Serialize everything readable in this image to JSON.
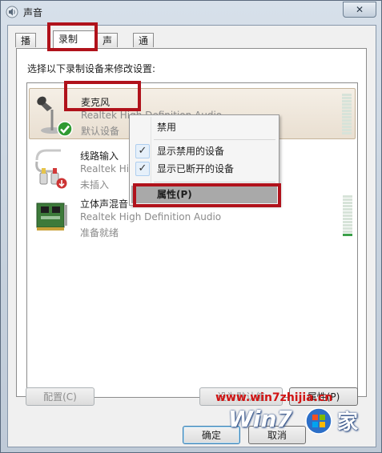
{
  "window": {
    "title": "声音",
    "close_glyph": "✕"
  },
  "tabs": [
    {
      "label": "播放",
      "active": false
    },
    {
      "label": "录制",
      "active": true
    },
    {
      "label": "声音",
      "active": false
    },
    {
      "label": "通信",
      "active": false
    }
  ],
  "panel": {
    "instruction": "选择以下录制设备来修改设置:"
  },
  "devices": [
    {
      "name": "麦克风",
      "description": "Realtek High Definition Audio",
      "status": "默认设备",
      "icon": "microphone-icon",
      "badge": "default-check-icon",
      "selected": true
    },
    {
      "name": "线路输入",
      "description": "Realtek High Definition Audio",
      "status": "未插入",
      "icon": "line-in-cable-icon",
      "badge": "unplugged-arrow-icon",
      "selected": false
    },
    {
      "name": "立体声混音",
      "description": "Realtek High Definition Audio",
      "status": "准备就绪",
      "icon": "sound-card-icon",
      "badge": "",
      "selected": false
    }
  ],
  "context_menu": {
    "items": [
      {
        "label": "禁用",
        "checked": false
      },
      {
        "label": "显示禁用的设备",
        "checked": true
      },
      {
        "label": "显示已断开的设备",
        "checked": true
      },
      {
        "label": "属性(P)",
        "checked": false,
        "highlighted": true
      }
    ],
    "check_glyph": "✓"
  },
  "buttons": {
    "configure": "配置(C)",
    "set_default": "设为默认值",
    "properties": "属性(P)",
    "ok": "确定",
    "cancel": "取消"
  },
  "watermark": {
    "url": "www.win7zhijia.cn",
    "brand": "Win7",
    "suffix": "家"
  },
  "colors": {
    "highlight_box": "#b0121b",
    "level_green": "#3ca04a",
    "selection": "#e9dfd1"
  }
}
